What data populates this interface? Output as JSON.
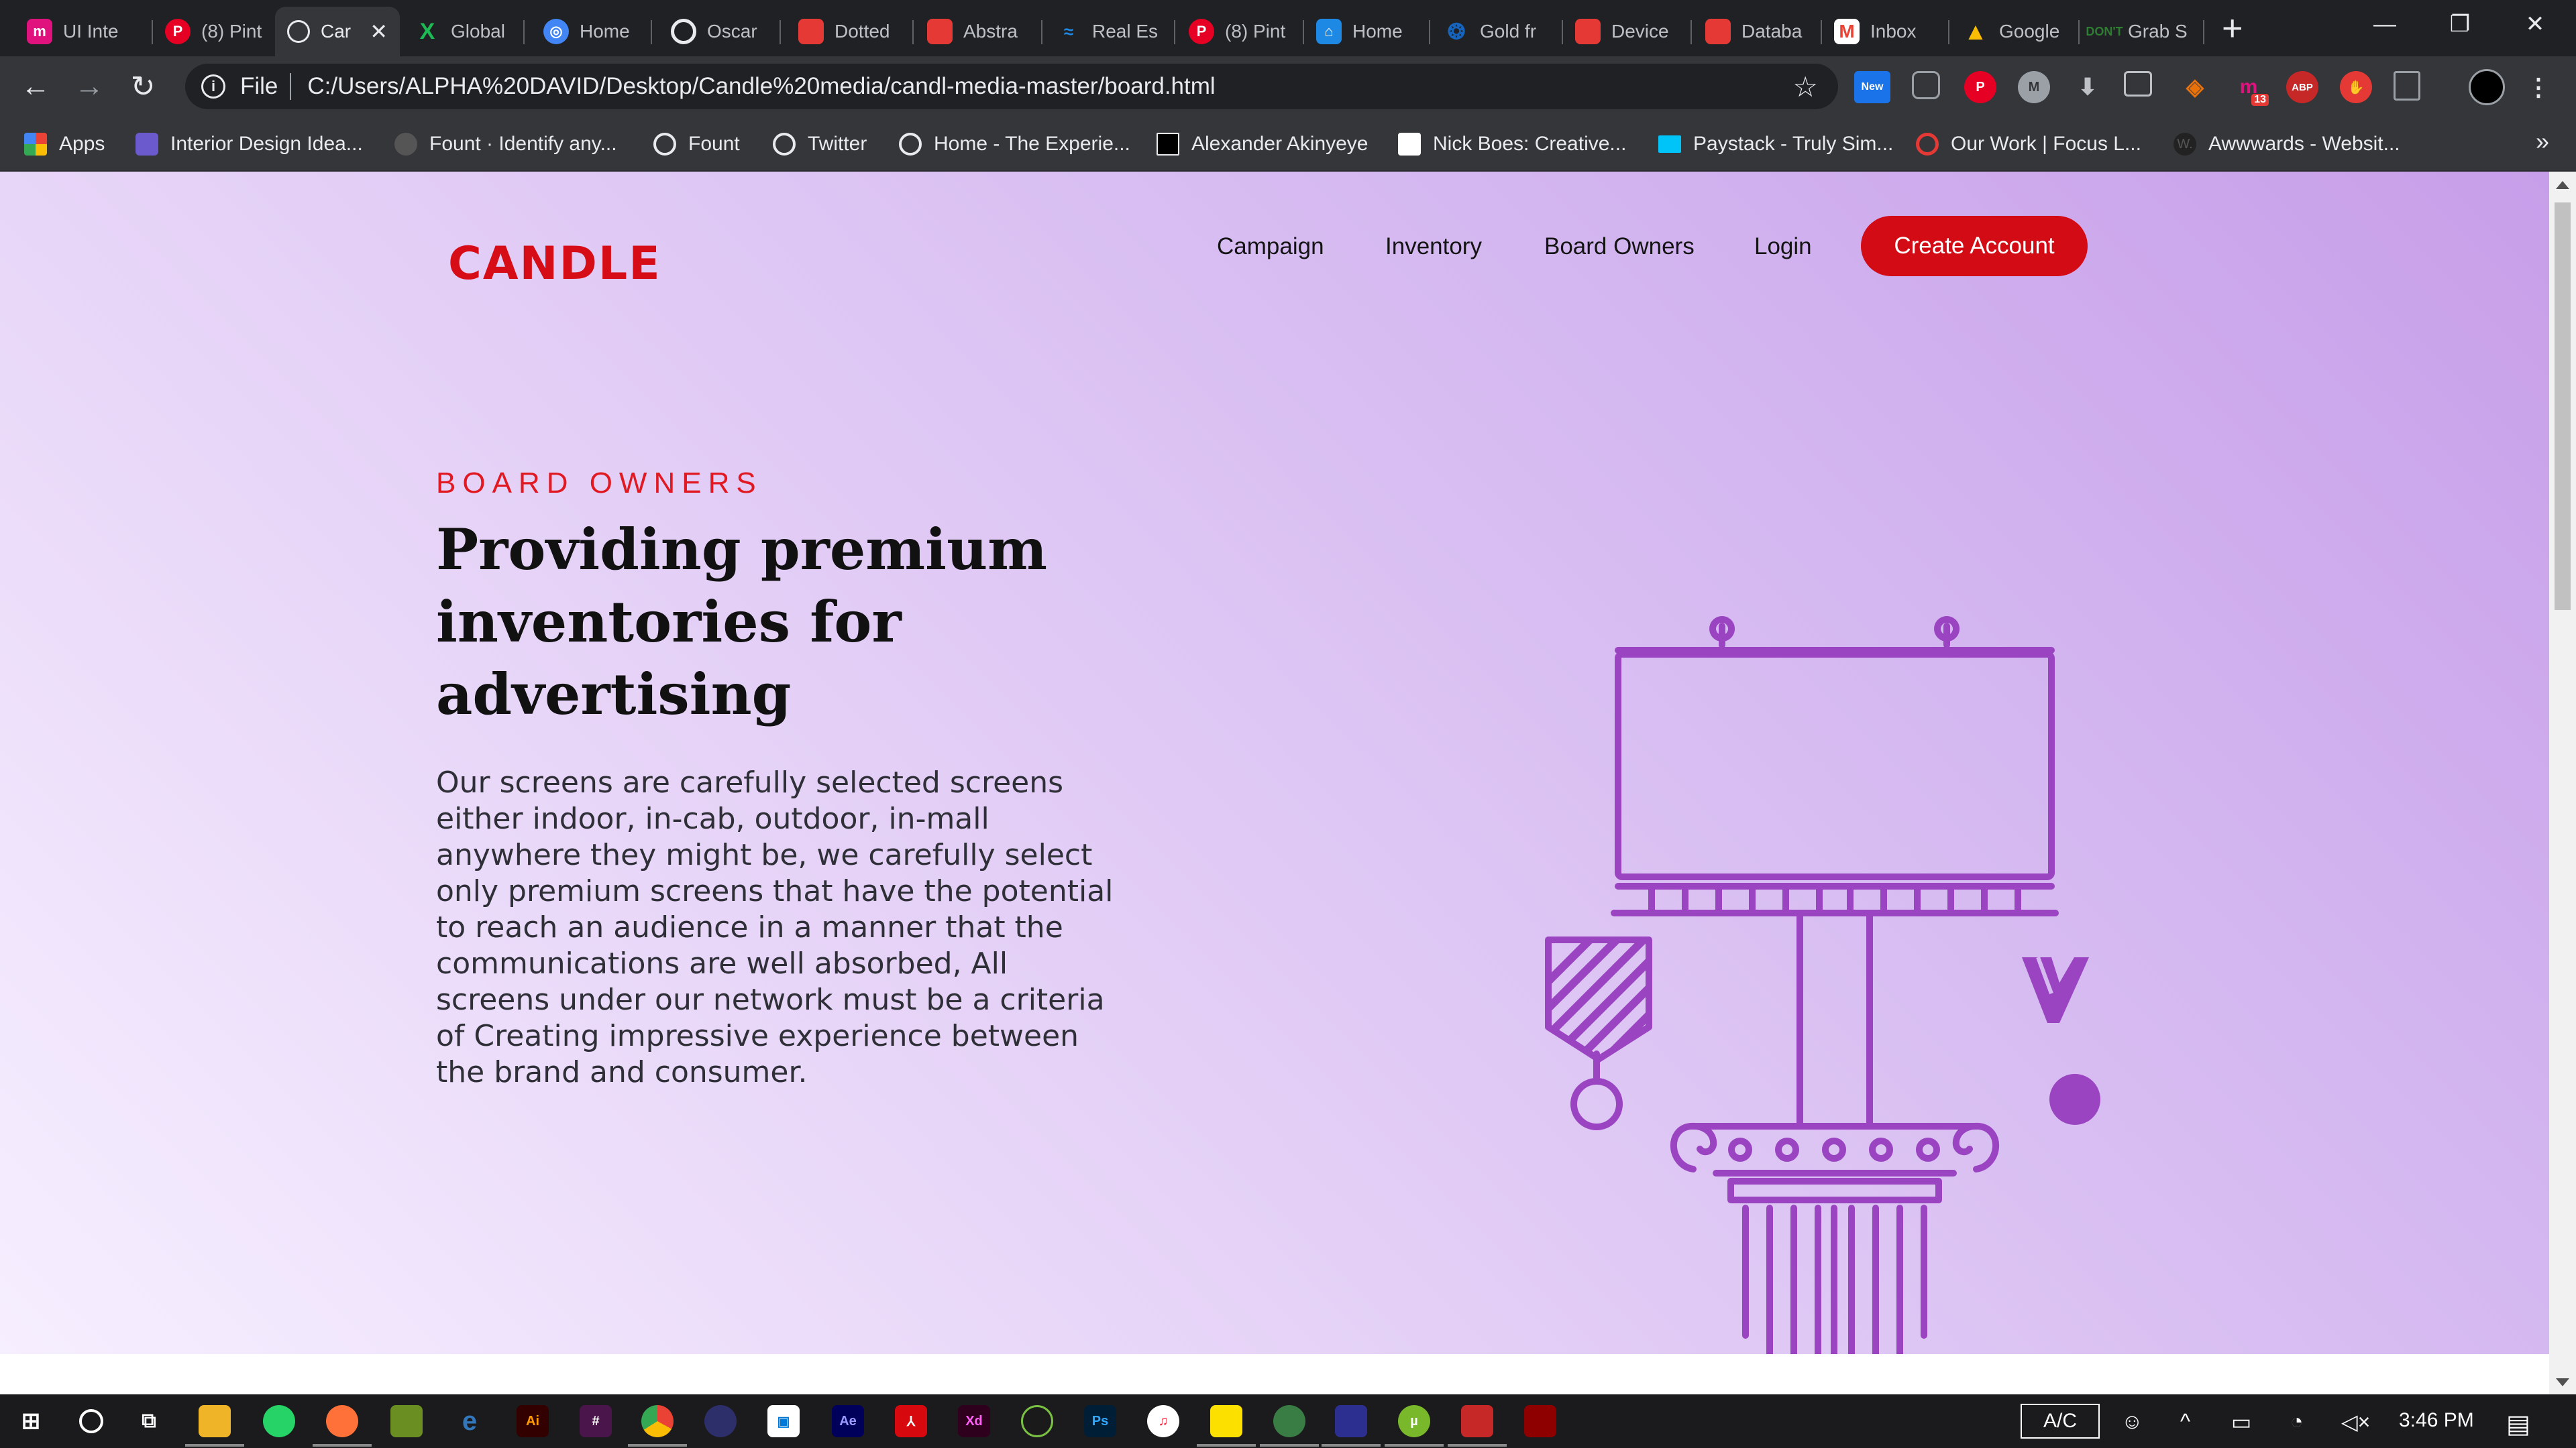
{
  "browser": {
    "tabs": [
      {
        "label": "UI Inte",
        "icon": "m-logo-icon",
        "color": "#e0137e"
      },
      {
        "label": "(8) Pint",
        "icon": "pinterest-icon",
        "color": "#e60023"
      },
      {
        "label": "Car",
        "icon": "globe-icon",
        "color": "#e8eaed",
        "active": true
      },
      {
        "label": "Global",
        "icon": "global-icon",
        "color": "#1db954"
      },
      {
        "label": "Home",
        "icon": "home-icon",
        "color": "#4285f4"
      },
      {
        "label": "Oscar",
        "icon": "oscar-icon",
        "color": "#e8eaed"
      },
      {
        "label": "Dotted",
        "icon": "dribbble-shot-icon",
        "color": "#e53935"
      },
      {
        "label": "Abstra",
        "icon": "dribbble-shot-icon",
        "color": "#e53935"
      },
      {
        "label": "Real Es",
        "icon": "realestate-icon",
        "color": "#1e88e5"
      },
      {
        "label": "(8) Pint",
        "icon": "pinterest-icon",
        "color": "#e60023"
      },
      {
        "label": "Home",
        "icon": "home-icon",
        "color": "#1e88e5"
      },
      {
        "label": "Gold fr",
        "icon": "gold-icon",
        "color": "#1565c0"
      },
      {
        "label": "Device",
        "icon": "dribbble-shot-icon",
        "color": "#e53935"
      },
      {
        "label": "Databa",
        "icon": "dribbble-shot-icon",
        "color": "#e53935"
      },
      {
        "label": "Inbox",
        "icon": "gmail-icon",
        "color": "#ea4335"
      },
      {
        "label": "Google",
        "icon": "drive-icon",
        "color": "#fbbc04"
      },
      {
        "label": "Grab S",
        "icon": "dont-icon",
        "color": "#2e7d32"
      }
    ],
    "address": {
      "scheme_label": "File",
      "url": "C:/Users/ALPHA%20DAVID/Desktop/Candle%20media/candl-media-master/board.html"
    },
    "extensions": [
      "new-badge-icon",
      "pocket-icon",
      "pinterest-icon",
      "m-icon",
      "download-icon",
      "image-icon",
      "share-icon",
      "notification-13-icon",
      "abp-icon",
      "stop-icon",
      "pdf-icon",
      "profile-avatar-icon"
    ],
    "extension_badges": {
      "new": "New",
      "count": "13",
      "abp": "ABP"
    },
    "bookmarks": [
      {
        "label": "Apps",
        "icon": "apps-grid-icon",
        "color": "#ea4335"
      },
      {
        "label": "Interior Design Idea...",
        "icon": "cube-icon",
        "color": "#6a5acd"
      },
      {
        "label": "Fount · Identify any...",
        "icon": "fount-icon",
        "color": "#555555"
      },
      {
        "label": "Fount",
        "icon": "globe-icon",
        "color": "#e8eaed"
      },
      {
        "label": "Twitter",
        "icon": "globe-icon",
        "color": "#e8eaed"
      },
      {
        "label": "Home - The Experie...",
        "icon": "globe-icon",
        "color": "#e8eaed"
      },
      {
        "label": "Alexander Akinyeye",
        "icon": "mountain-icon",
        "color": "#000000"
      },
      {
        "label": "Nick Boes: Creative...",
        "icon": "nb-icon",
        "color": "#000000"
      },
      {
        "label": "Paystack - Truly Sim...",
        "icon": "paystack-icon",
        "color": "#00c3f7"
      },
      {
        "label": "Our Work | Focus L...",
        "icon": "focus-icon",
        "color": "#e53935"
      },
      {
        "label": "Awwwards - Websit...",
        "icon": "awwwards-icon",
        "color": "#222222"
      }
    ]
  },
  "site": {
    "logo": "CANDLE",
    "nav": {
      "campaign": "Campaign",
      "inventory": "Inventory",
      "board_owners": "Board Owners",
      "login": "Login",
      "cta": "Create Account"
    },
    "hero": {
      "eyebrow": "BOARD OWNERS",
      "headline": "Providing premium inventories for advertising",
      "body": "Our screens are carefully selected screens either indoor, in-cab, outdoor, in-mall anywhere they might be, we carefully select only premium screens that have the potential to reach an audience in a manner that the communications are well absorbed, All screens under our network must be a criteria of Creating impressive experience between the brand and consumer."
    },
    "colors": {
      "brand_red": "#d20b14",
      "illustration_purple": "#9b44c2"
    }
  },
  "taskbar": {
    "apps": [
      "windows-start-icon",
      "cortana-icon",
      "task-view-icon",
      "file-explorer-icon",
      "whatsapp-icon",
      "firefox-icon",
      "app-icon",
      "edge-icon",
      "illustrator-icon",
      "slack-icon",
      "chrome-icon",
      "app-icon",
      "store-icon",
      "after-effects-icon",
      "acrobat-icon",
      "xd-icon",
      "app-icon",
      "photoshop-icon",
      "itunes-icon",
      "sticky-notes-icon",
      "app-icon",
      "app-icon",
      "utorrent-icon",
      "app-icon",
      "app-icon"
    ],
    "app_labels": {
      "illustrator": "Ai",
      "after_effects": "Ae",
      "xd": "Xd",
      "photoshop": "Ps"
    },
    "ac_label": "A/C",
    "time": "3:46 PM"
  }
}
